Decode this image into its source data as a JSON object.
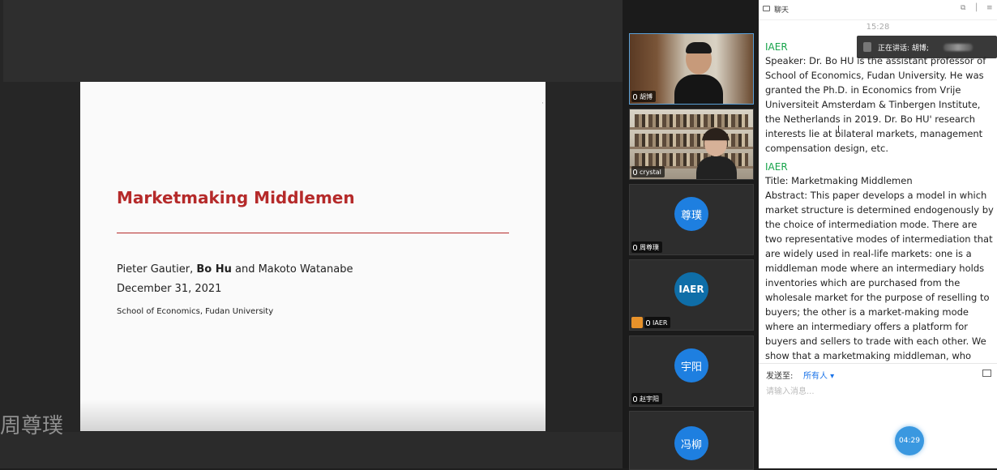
{
  "slide": {
    "title": "Marketmaking Middlemen",
    "authors_pre": "Pieter Gautier, ",
    "authors_bold": "Bo Hu",
    "authors_post": " and Makoto Watanabe",
    "date": "December 31, 2021",
    "institution": "School of Economics, Fudan University"
  },
  "watermark": "周尊璞",
  "participants": [
    {
      "name": "胡博"
    },
    {
      "name": "crystal"
    },
    {
      "name": "周尊璞",
      "avatar_text": "尊璞"
    },
    {
      "name": "IAER",
      "avatar_text": "IAER"
    },
    {
      "name": "赵宇阳",
      "avatar_text": "宇阳"
    },
    {
      "avatar_text": "冯柳"
    }
  ],
  "chat": {
    "title": "聊天",
    "time": "15:28",
    "speaking_label": "正在讲话: 胡博;",
    "messages": [
      {
        "sender": "IAER",
        "text": "Speaker: Dr. Bo HU is the assistant professor of School of Economics, Fudan University. He was granted the Ph.D. in Economics from Vrije Universiteit Amsterdam & Tinbergen Institute, the Netherlands in 2019. Dr. Bo HU' research interests lie at bilateral markets, management compensation design, etc."
      },
      {
        "sender": "IAER",
        "text_title": "Title: Marketmaking Middlemen",
        "text": "Abstract: This paper develops a model in which market structure is determined endogenously by the choice of intermediation mode. There are two representative modes of intermediation that are widely used in real-life markets: one is a middleman mode where an intermediary holds inventories which are purchased from the wholesale market for the purpose of reselling to buyers; the other is a market-making mode where an intermediary offers a platform for buyers and sellers to trade with each other. We show that a marketmaking middleman, who adopts a mixture of the two intermediation modes, can emerge in equilibrium."
      }
    ],
    "send_to_label": "发送至:",
    "send_to_value": "所有人 ▾",
    "input_placeholder": "请输入消息...",
    "timer": "04:29"
  },
  "colors": {
    "slide_title": "#b52a2a",
    "sender": "#16a34a",
    "avatar_blue": "#1e7fe0",
    "link_blue": "#1a73e8"
  }
}
